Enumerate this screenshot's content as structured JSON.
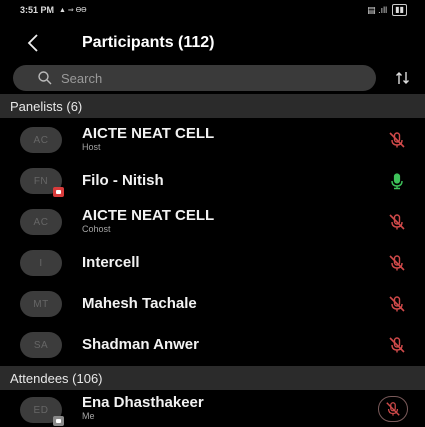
{
  "status_bar": {
    "time": "3:51 PM",
    "left_icons": "• • ",
    "carrier": "→ ƧƧ",
    "right": "▣ .∵.ıll",
    "battery": "▮▮"
  },
  "header": {
    "title": "Participants (112)"
  },
  "search": {
    "placeholder": "Search"
  },
  "sections": {
    "panelists_label": "Panelists (6)",
    "attendees_label": "Attendees (106)"
  },
  "participants": [
    {
      "initials": "AC",
      "name": "AICTE NEAT CELL",
      "role": "Host",
      "mic": "muted",
      "badge": ""
    },
    {
      "initials": "FN",
      "name": "Filo - Nitish",
      "role": "",
      "mic": "on",
      "badge": "red"
    },
    {
      "initials": "AC",
      "name": "AICTE NEAT CELL",
      "role": "Cohost",
      "mic": "muted",
      "badge": ""
    },
    {
      "initials": "I",
      "name": "Intercell",
      "role": "",
      "mic": "muted",
      "badge": ""
    },
    {
      "initials": "MT",
      "name": "Mahesh Tachale",
      "role": "",
      "mic": "muted",
      "badge": ""
    },
    {
      "initials": "SA",
      "name": "Shadman Anwer",
      "role": "",
      "mic": "muted",
      "badge": ""
    }
  ],
  "attendees": [
    {
      "initials": "ED",
      "name": "Ena Dhasthakeer",
      "role": "Me",
      "mic": "muted-circled",
      "badge": "gray"
    }
  ],
  "colors": {
    "background": "#000000",
    "section_bg": "#2b2b2b",
    "search_bg": "#3a3a3a",
    "mic_muted": "#d04a4a",
    "mic_on": "#3ec25a",
    "avatar_bg": "#3c3c3c"
  },
  "icons": {
    "back": "chevron-left-icon",
    "search": "search-icon",
    "sort": "sort-icon",
    "mic_muted": "mic-muted-icon",
    "mic_on": "mic-icon"
  }
}
